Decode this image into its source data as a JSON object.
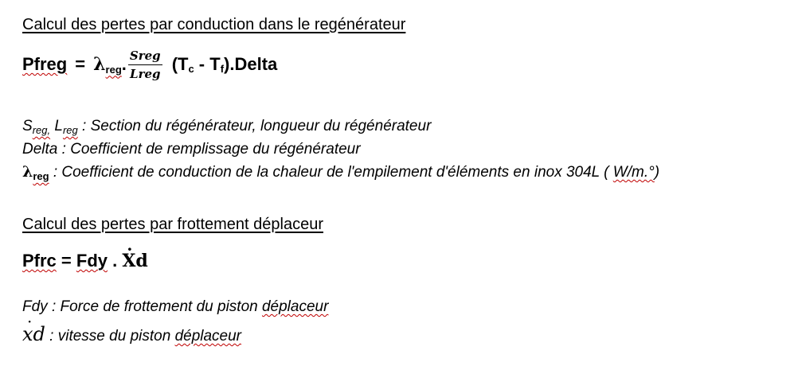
{
  "section1": {
    "heading": "Calcul des pertes par conduction dans le regénérateur",
    "formula": {
      "lhs": "Pfreg",
      "equals": "=",
      "lambda": "λ",
      "lambda_sub": "reg",
      "dot_op": ".",
      "frac_num": "Sreg",
      "frac_den": "Lreg",
      "paren_open": "(T",
      "tc_sub": "c",
      "minus": " - T",
      "tf_sub": "f",
      "tail": ").Delta"
    },
    "desc": {
      "s": "S",
      "s_sub": "reg,",
      "l": " L",
      "l_sub": "reg",
      "s_text": " : Section du régénérateur, longueur du régénérateur",
      "delta_line": "Delta : Coefficient de remplissage du régénérateur",
      "lambda": "λ",
      "lambda_sub": "reg",
      "lambda_text": " : Coefficient de conduction de la chaleur de l'empilement d'éléments en inox 304L ( ",
      "unit": "W/m.°",
      "unit_close": ")"
    }
  },
  "section2": {
    "heading": "Calcul des pertes par frottement déplaceur",
    "formula": {
      "lhs": "Pfrc",
      "mid": " = ",
      "fdy": "Fdy",
      "dot_op": " . ",
      "xd": "Xd",
      "dot": "·"
    },
    "desc": {
      "fdy_text_a": "Fdy : Force de frottement du piston ",
      "fdy_text_b": "déplaceur",
      "xd": "xd",
      "dot": "·",
      "xd_text_a": " : vitesse du piston ",
      "xd_text_b": "déplaceur"
    }
  }
}
